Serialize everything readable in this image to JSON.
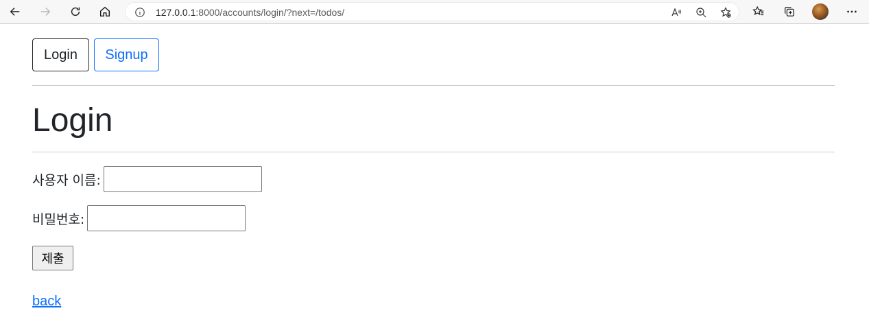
{
  "browser": {
    "url_host": "127.0.0.1",
    "url_rest": ":8000/accounts/login/?next=/todos/"
  },
  "nav": {
    "login_label": "Login",
    "signup_label": "Signup"
  },
  "page": {
    "title": "Login"
  },
  "form": {
    "username_label": "사용자 이름:",
    "username_value": "",
    "password_label": "비밀번호:",
    "password_value": "",
    "submit_label": "제출"
  },
  "links": {
    "back_label": "back"
  },
  "colors": {
    "primary": "#0d6efd",
    "text": "#212529"
  }
}
